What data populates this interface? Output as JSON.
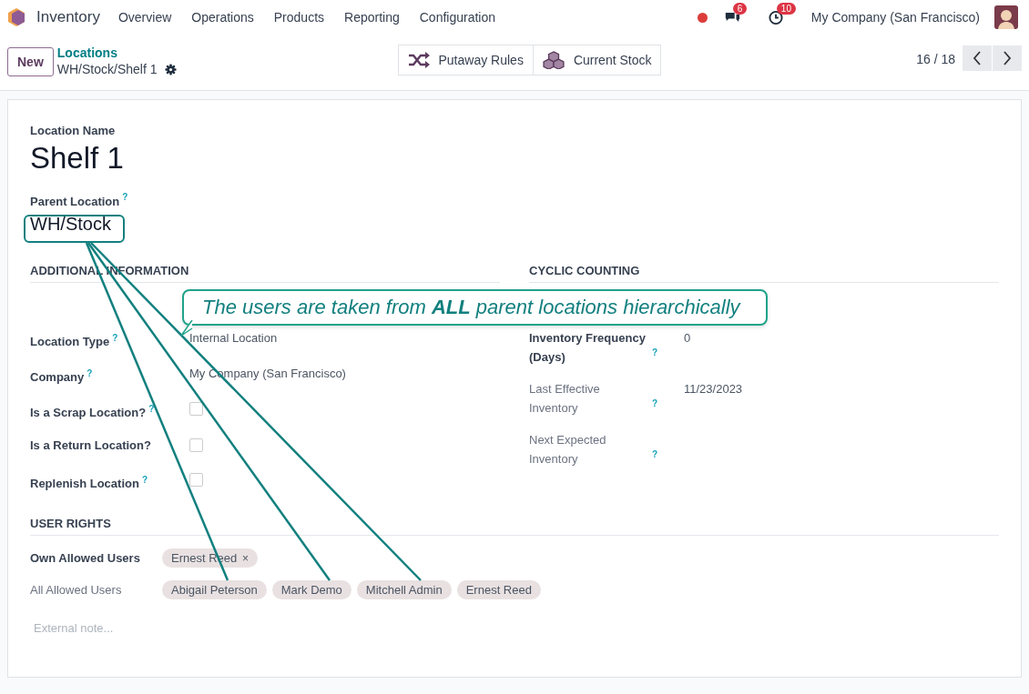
{
  "navbar": {
    "app_name": "Inventory",
    "menu": [
      "Overview",
      "Operations",
      "Products",
      "Reporting",
      "Configuration"
    ],
    "chat_count": "6",
    "activity_count": "10",
    "company": "My Company (San Francisco)"
  },
  "control_panel": {
    "new_button": "New",
    "breadcrumb_parent": "Locations",
    "breadcrumb_current": "WH/Stock/Shelf 1",
    "actions": [
      {
        "kind": "shuffle",
        "label": "Putaway Rules"
      },
      {
        "kind": "boxes",
        "label": "Current Stock"
      }
    ],
    "pager": "16 / 18"
  },
  "form": {
    "name_label": "Location Name",
    "name": "Shelf 1",
    "parent_label": "Parent Location",
    "parent_help": "?",
    "parent_value": "WH/Stock",
    "sections": [
      {
        "title": "ADDITIONAL INFORMATION",
        "fields": [
          {
            "label": "Location Type",
            "help": "?",
            "kind": "text",
            "value": "Internal Location",
            "strong": true
          },
          {
            "label": "Company",
            "help": "?",
            "kind": "text",
            "value": "My Company (San Francisco)",
            "strong": true
          },
          {
            "label": "Is a Scrap Location?",
            "help": "?",
            "kind": "checkbox",
            "checked": false,
            "strong": true
          },
          {
            "label": "Is a Return Location?",
            "kind": "checkbox",
            "checked": false,
            "strong": true
          },
          {
            "label": "Replenish Location",
            "help": "?",
            "kind": "checkbox",
            "checked": false,
            "strong": true
          }
        ]
      },
      {
        "title": "CYCLIC COUNTING",
        "fields": [
          {
            "label": "Inventory Frequency (Days)",
            "help": "?",
            "kind": "text",
            "value": "0",
            "strong": true
          },
          {
            "label": "Last Effective Inventory",
            "help": "?",
            "kind": "text",
            "value": "11/23/2023",
            "strong": false
          },
          {
            "label": "Next Expected Inventory",
            "help": "?",
            "kind": "text",
            "strong": false
          }
        ]
      }
    ],
    "user_rights": {
      "title": "USER RIGHTS",
      "own_label": "Own Allowed Users",
      "own_users": [
        {
          "name": "Ernest Reed",
          "remove": "×"
        }
      ],
      "all_label": "All Allowed Users",
      "all_users": [
        "Abigail Peterson",
        "Mark Demo",
        "Mitchell Admin",
        "Ernest Reed"
      ]
    },
    "note_placeholder": "External note..."
  },
  "callout": {
    "text": "The users are taken from **ALL** parent locations hierarchically"
  }
}
